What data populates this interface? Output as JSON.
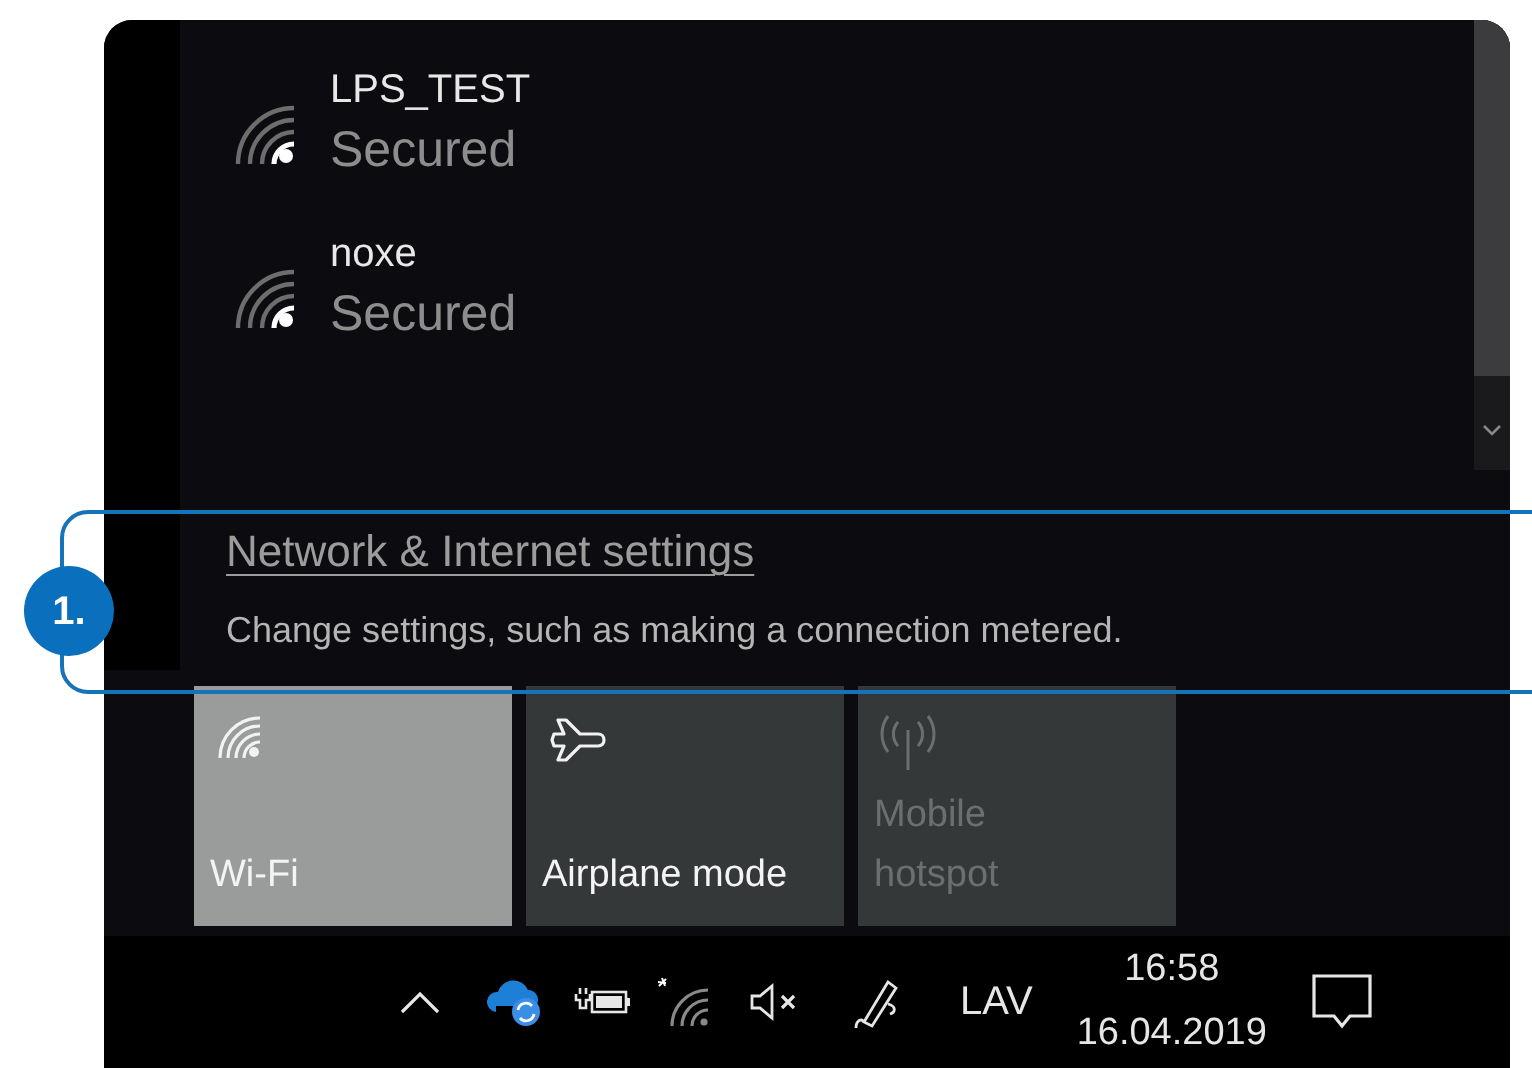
{
  "networks": [
    {
      "name": "LPS_TEST",
      "status": "Secured"
    },
    {
      "name": "noxe",
      "status": "Secured"
    }
  ],
  "settings": {
    "link": "Network & Internet settings",
    "description": "Change settings, such as making a connection metered."
  },
  "callout": {
    "label": "1."
  },
  "tiles": [
    {
      "kind": "wifi",
      "label": "Wi-Fi",
      "on": true,
      "disabled": false
    },
    {
      "kind": "airplane",
      "label": "Airplane mode",
      "on": false,
      "disabled": false
    },
    {
      "kind": "hotspot",
      "label": "Mobile\nhotspot",
      "on": false,
      "disabled": true
    }
  ],
  "taskbar": {
    "language": "LAV",
    "time": "16:58",
    "date": "16.04.2019",
    "volume_muted": true
  }
}
